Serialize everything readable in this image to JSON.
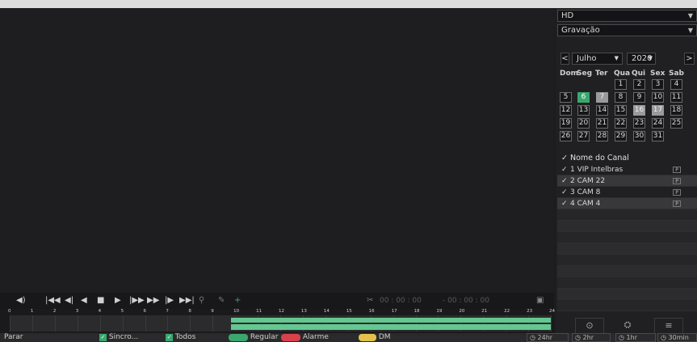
{
  "header": {
    "quality": "HD",
    "mode": "Gravação"
  },
  "calendar": {
    "month": "Julho",
    "year": "2020",
    "weekdays": [
      "Dom",
      "Seg",
      "Ter",
      "Qua",
      "Qui",
      "Sex",
      "Sab"
    ],
    "weeks": [
      [
        "",
        "",
        "",
        "1",
        "2",
        "3",
        "4"
      ],
      [
        "5",
        "6",
        "7",
        "8",
        "9",
        "10",
        "11"
      ],
      [
        "12",
        "13",
        "14",
        "15",
        "16",
        "17",
        "18"
      ],
      [
        "19",
        "20",
        "21",
        "22",
        "23",
        "24",
        "25"
      ],
      [
        "26",
        "27",
        "28",
        "29",
        "30",
        "31",
        ""
      ]
    ],
    "recorded_days": [
      "6"
    ],
    "highlighted_days": [
      "7",
      "16",
      "17"
    ]
  },
  "channels": {
    "header": "Nome do Canal",
    "items": [
      {
        "label": "1 VIP Intelbras",
        "badge": "P"
      },
      {
        "label": "2 CAM 22",
        "badge": "P"
      },
      {
        "label": "3 CAM 8",
        "badge": "P"
      },
      {
        "label": "4 CAM 4",
        "badge": "P"
      }
    ]
  },
  "controls": {
    "time_start": "00 : 00 : 00",
    "time_end": "- 00 : 00 : 00"
  },
  "timeline": {
    "hours": [
      "0",
      "1",
      "2",
      "3",
      "4",
      "5",
      "6",
      "7",
      "8",
      "9",
      "10",
      "11",
      "12",
      "13",
      "14",
      "15",
      "16",
      "17",
      "18",
      "19",
      "20",
      "21",
      "22",
      "23",
      "24"
    ],
    "recording_start_hour": 9.8,
    "recording_end_hour": 24,
    "recording_color": "#64c791"
  },
  "status": {
    "left": "Parar",
    "sync": "Sincro...",
    "all": "Todos",
    "legend": [
      {
        "label": "Regular",
        "color": "#3aa76d"
      },
      {
        "label": "Alarme",
        "color": "#d9414a"
      },
      {
        "label": "DM",
        "color": "#e3c24b"
      }
    ],
    "zoom": [
      "24hr",
      "2hr",
      "1hr",
      "30min"
    ]
  },
  "colors": {
    "accent": "#3aa76d",
    "background": "#1c1c1e"
  }
}
